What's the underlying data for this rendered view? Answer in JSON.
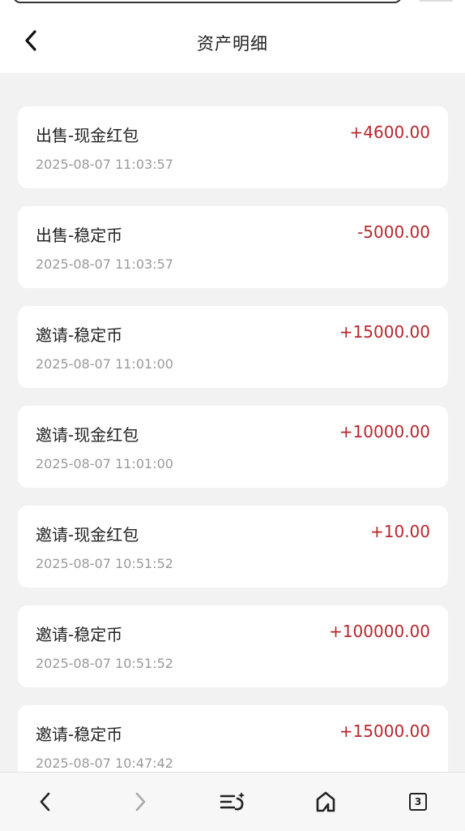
{
  "header": {
    "title": "资产明细",
    "back_icon": "chevron-left-icon"
  },
  "transactions": [
    {
      "title": "出售-现金红包",
      "time": "2025-08-07 11:03:57",
      "amount": "+4600.00"
    },
    {
      "title": "出售-稳定币",
      "time": "2025-08-07 11:03:57",
      "amount": "-5000.00"
    },
    {
      "title": "邀请-稳定币",
      "time": "2025-08-07 11:01:00",
      "amount": "+15000.00"
    },
    {
      "title": "邀请-现金红包",
      "time": "2025-08-07 11:01:00",
      "amount": "+10000.00"
    },
    {
      "title": "邀请-现金红包",
      "time": "2025-08-07 10:51:52",
      "amount": "+10.00"
    },
    {
      "title": "邀请-稳定币",
      "time": "2025-08-07 10:51:52",
      "amount": "+100000.00"
    },
    {
      "title": "邀请-稳定币",
      "time": "2025-08-07 10:47:42",
      "amount": "+15000.00"
    }
  ],
  "browser_bar": {
    "tab_count": "3",
    "icons": [
      "back-icon",
      "forward-icon",
      "menu-sparkle-icon",
      "home-icon",
      "tabs-icon"
    ]
  },
  "colors": {
    "amount": "#b5272d",
    "background": "#f2f2f3",
    "card": "#ffffff"
  }
}
